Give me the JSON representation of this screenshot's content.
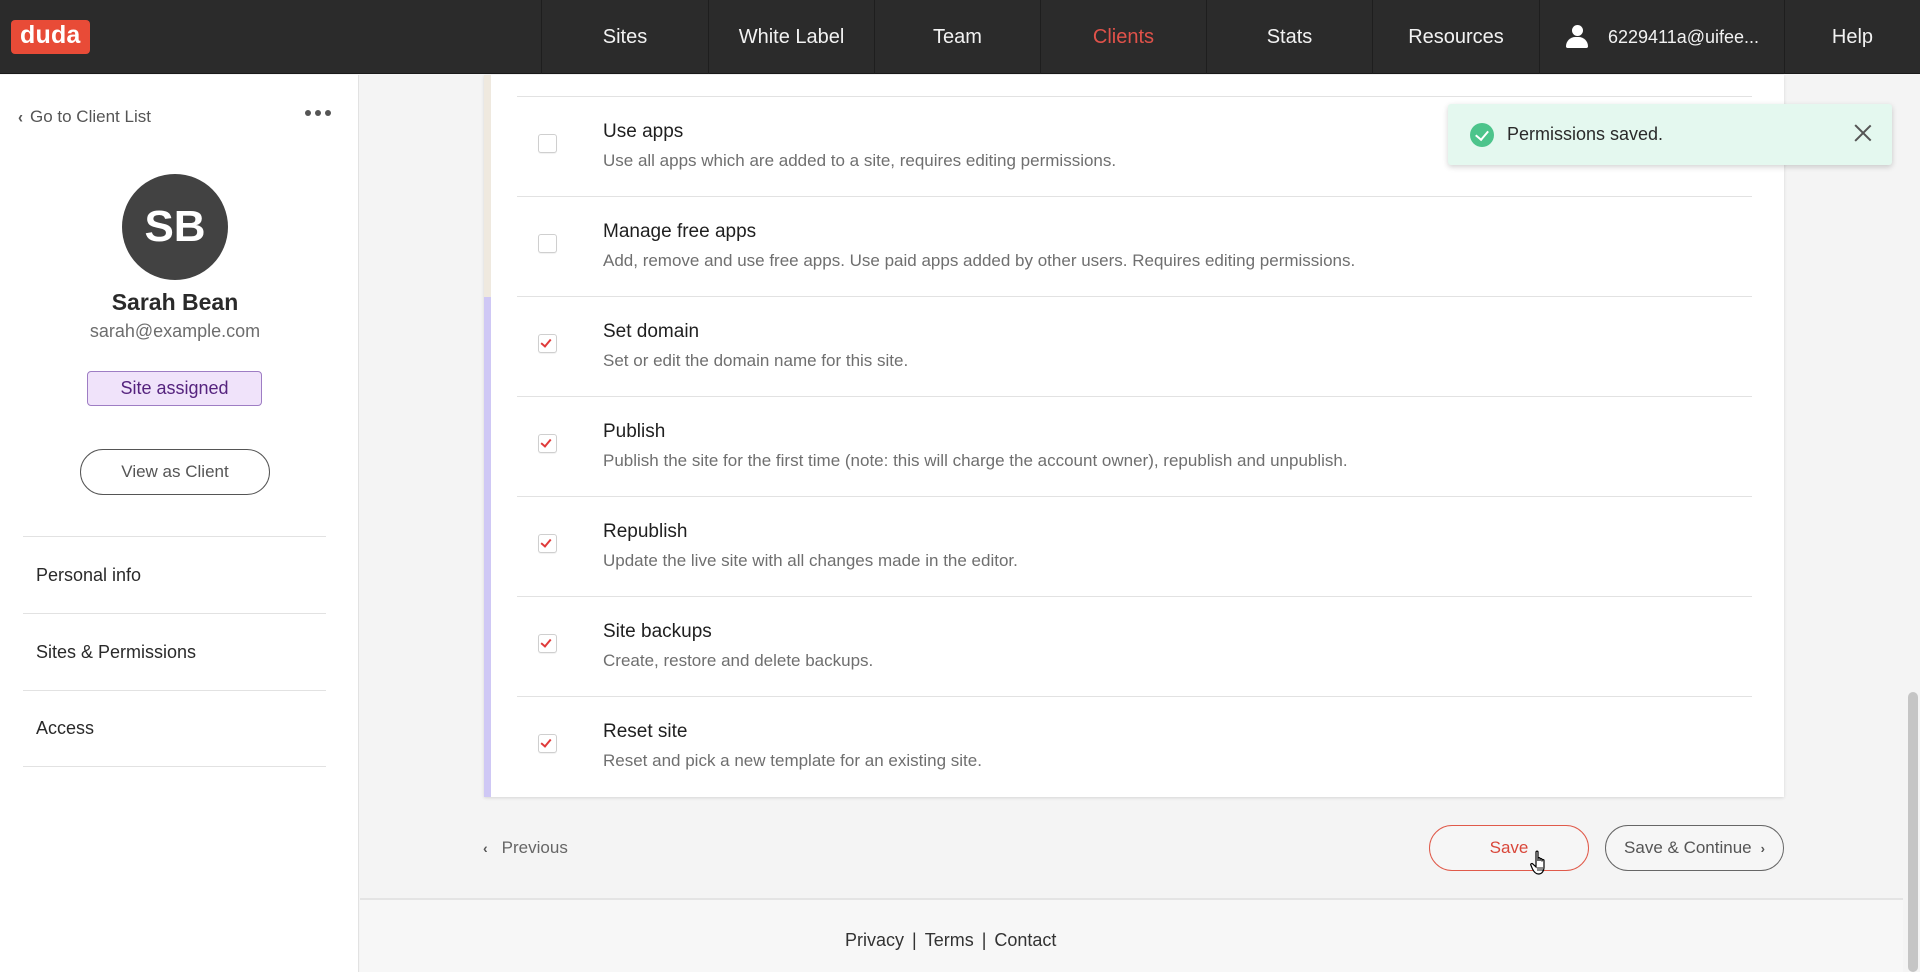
{
  "brand": {
    "logo_text": "duda",
    "accent_color": "#e84b37"
  },
  "topnav": {
    "items": [
      {
        "label": "Sites",
        "active": false
      },
      {
        "label": "White Label",
        "active": false
      },
      {
        "label": "Team",
        "active": false
      },
      {
        "label": "Clients",
        "active": true
      },
      {
        "label": "Stats",
        "active": false
      },
      {
        "label": "Resources",
        "active": false
      }
    ],
    "account_label": "6229411a@uifee...",
    "account_icon": "user-icon",
    "help_label": "Help"
  },
  "sidebar": {
    "back_label": "Go to Client List",
    "more_icon": "more-horizontal-icon",
    "avatar_initials": "SB",
    "client_name": "Sarah Bean",
    "client_email": "sarah@example.com",
    "status_badge": "Site assigned",
    "view_as_client_label": "View as Client",
    "menu": [
      {
        "label": "Personal info"
      },
      {
        "label": "Sites & Permissions"
      },
      {
        "label": "Access"
      }
    ]
  },
  "permissions": [
    {
      "title": "Use apps",
      "description": "Use all apps which are added to a site, requires editing permissions.",
      "checked": false
    },
    {
      "title": "Manage free apps",
      "description": "Add, remove and use free apps. Use paid apps added by other users. Requires editing permissions.",
      "checked": false
    },
    {
      "title": "Set domain",
      "description": "Set or edit the domain name for this site.",
      "checked": true
    },
    {
      "title": "Publish",
      "description": "Publish the site for the first time (note: this will charge the account owner), republish and unpublish.",
      "checked": true
    },
    {
      "title": "Republish",
      "description": "Update the live site with all changes made in the editor.",
      "checked": true
    },
    {
      "title": "Site backups",
      "description": "Create, restore and delete backups.",
      "checked": true
    },
    {
      "title": "Reset site",
      "description": "Reset and pick a new template for an existing site.",
      "checked": true
    }
  ],
  "actions": {
    "previous_label": "Previous",
    "save_label": "Save",
    "save_continue_label": "Save & Continue"
  },
  "toast": {
    "message": "Permissions saved.",
    "icon": "check-circle-icon",
    "color": "#4cc48b"
  },
  "footer": {
    "links": [
      "Privacy",
      "Terms",
      "Contact"
    ],
    "separator": "|"
  }
}
